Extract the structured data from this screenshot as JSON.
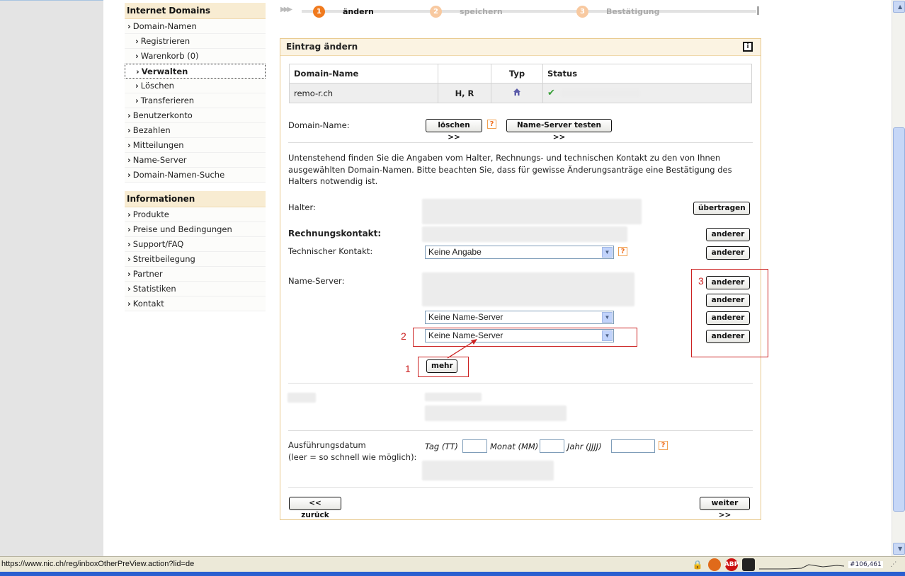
{
  "sidebar": {
    "section1_title": "Internet Domains",
    "section1_items": [
      {
        "label": "Domain-Namen"
      },
      {
        "label": "Registrieren"
      },
      {
        "label": "Warenkorb (0)"
      },
      {
        "label": "Verwalten"
      },
      {
        "label": "Löschen"
      },
      {
        "label": "Transferieren"
      },
      {
        "label": "Benutzerkonto"
      },
      {
        "label": "Bezahlen"
      },
      {
        "label": "Mitteilungen"
      },
      {
        "label": "Name-Server"
      },
      {
        "label": "Domain-Namen-Suche"
      }
    ],
    "section2_title": "Informationen",
    "section2_items": [
      {
        "label": "Produkte"
      },
      {
        "label": "Preise und Bedingungen"
      },
      {
        "label": "Support/FAQ"
      },
      {
        "label": "Streitbeilegung"
      },
      {
        "label": "Partner"
      },
      {
        "label": "Statistiken"
      },
      {
        "label": "Kontakt"
      }
    ]
  },
  "steps": [
    {
      "num": "1",
      "label": "ändern"
    },
    {
      "num": "2",
      "label": "speichern"
    },
    {
      "num": "3",
      "label": "Bestätigung"
    }
  ],
  "panel": {
    "title": "Eintrag ändern",
    "info_icon": "i",
    "table": {
      "headers": [
        "Domain-Name",
        "",
        "Typ",
        "Status"
      ],
      "row": {
        "domain": "remo-r.ch",
        "flags": "H, R"
      }
    },
    "domain_label": "Domain-Name:",
    "delete_button": "löschen >>",
    "test_ns_button": "Name-Server testen >>",
    "help_mark": "?",
    "intro": "Untenstehend finden Sie die Angaben vom Halter, Rechnungs- und technischen Kontakt zu den von Ihnen ausgewählten Domain-Namen. Bitte beachten Sie, dass für gewisse Änderungsanträge eine Bestätigung des Halters notwendig ist.",
    "holder_label": "Halter:",
    "transfer_button": "übertragen",
    "billing_label": "Rechnungskontakt:",
    "other_button": "anderer",
    "tech_label": "Technischer Kontakt:",
    "tech_select": "Keine Angabe",
    "ns_label": "Name-Server:",
    "ns_select3": "Keine Name-Server",
    "ns_select4": "Keine Name-Server",
    "more_button": "mehr",
    "date_label": "Ausführungsdatum",
    "date_hint": "(leer = so schnell wie möglich):",
    "day_label": "Tag (TT)",
    "month_label": "Monat (MM)",
    "year_label": "Jahr (JJJJ)",
    "back_button": "<< zurück",
    "next_button": "weiter >>"
  },
  "annotations": {
    "n1": "1",
    "n2": "2",
    "n3": "3"
  },
  "statusbar": {
    "url": "https://www.nic.ch/reg/inboxOtherPreView.action?lid=de",
    "coords": "#106,461"
  },
  "colors": {
    "accent": "#f07a1e",
    "panel_border": "#e8c98e",
    "annotation": "#cc2222"
  }
}
